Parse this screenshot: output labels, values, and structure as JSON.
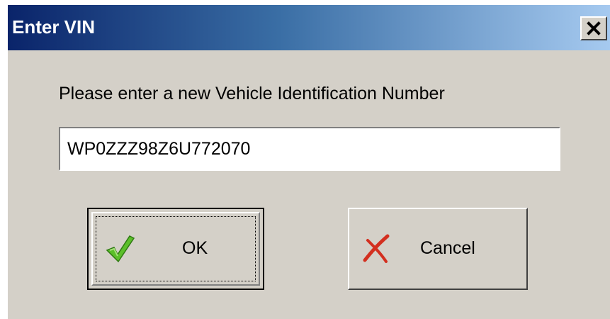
{
  "window": {
    "title": "Enter VIN",
    "close_icon": "close-icon"
  },
  "prompt": {
    "text": "Please enter a new Vehicle Identification Number"
  },
  "vin_input": {
    "value": "WP0ZZZ98Z6U772070"
  },
  "buttons": {
    "ok": {
      "label": "OK",
      "icon": "checkmark-icon",
      "icon_color": "#4caf2a"
    },
    "cancel": {
      "label": "Cancel",
      "icon": "cross-icon",
      "icon_color": "#d32f1f"
    }
  },
  "colors": {
    "titlebar_start": "#0a246a",
    "titlebar_end": "#a6caf0",
    "dialog_bg": "#d4d0c8"
  }
}
